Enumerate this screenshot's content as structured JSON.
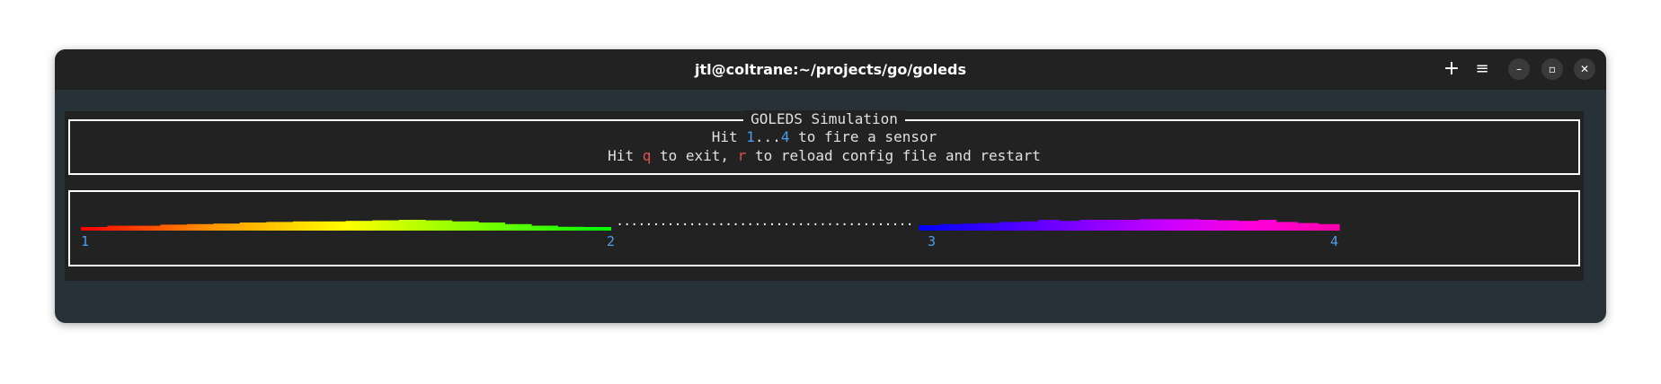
{
  "window": {
    "title": "jtl@coltrane:~/projects/go/goleds",
    "buttons": {
      "new_tab": "+",
      "menu": "≡",
      "minimize": "–",
      "maximize": "▫",
      "close": "✕"
    }
  },
  "info_box": {
    "title": "GOLEDS Simulation",
    "line1": {
      "prefix": "Hit ",
      "key_start": "1",
      "sep": "...",
      "key_end": "4",
      "suffix": " to fire a sensor"
    },
    "line2": {
      "prefix": "Hit ",
      "key_exit": "q",
      "mid": " to exit, ",
      "key_reload": "r",
      "suffix": " to reload config file and restart"
    }
  },
  "led_strip": {
    "sensors": [
      "1",
      "2",
      "3",
      "4"
    ],
    "dots": ".........................................",
    "segments": [
      {
        "from": 0.0,
        "to": 0.421,
        "colors": [
          "#ff0000",
          "#ff9900",
          "#ffff00",
          "#80ff00",
          "#00ff00"
        ],
        "levels": [
          0.3,
          0.45,
          0.45,
          0.55,
          0.6,
          0.65,
          0.75,
          0.8,
          0.85,
          0.85,
          0.9,
          0.95,
          1.0,
          0.95,
          0.85,
          0.75,
          0.6,
          0.45,
          0.35,
          0.25
        ]
      },
      {
        "from": 0.421,
        "to": 0.666,
        "dots": true
      },
      {
        "from": 0.666,
        "to": 1.0,
        "colors": [
          "#0000ff",
          "#4400ff",
          "#8800ff",
          "#cc00ff",
          "#ff00dd",
          "#ff00aa"
        ],
        "levels": [
          0.5,
          0.6,
          0.65,
          0.7,
          0.8,
          0.85,
          1.0,
          0.9,
          1.0,
          1.0,
          1.0,
          1.05,
          1.05,
          1.05,
          1.0,
          0.95,
          0.9,
          1.0,
          0.8,
          0.7,
          0.6
        ]
      }
    ]
  }
}
